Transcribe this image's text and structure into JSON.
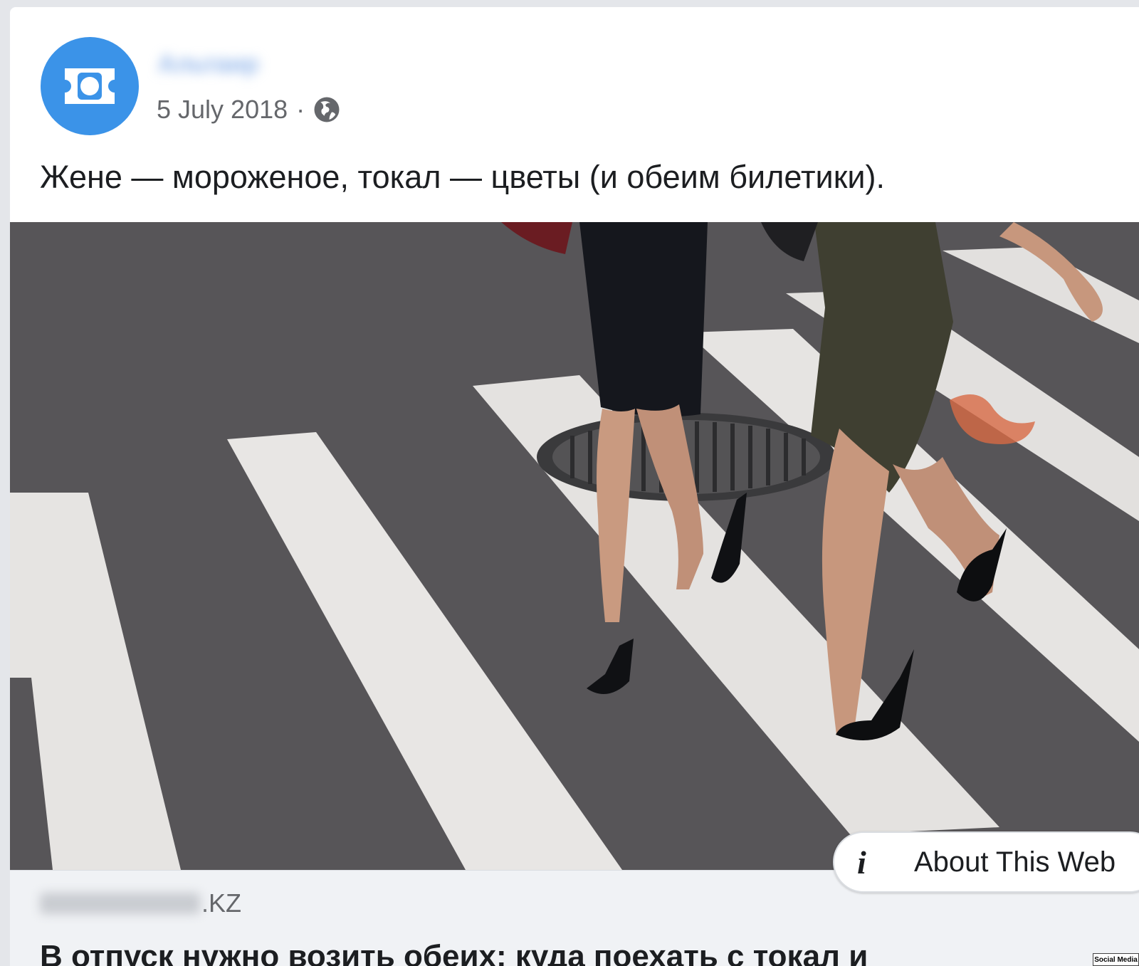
{
  "post": {
    "page_name": "Альтаир",
    "date": "5 July 2018",
    "separator": "·",
    "audience_icon": "globe-icon",
    "text": "Жене — мороженое, токал — цветы (и обеим билетики)."
  },
  "link_preview": {
    "image_icon": "crosswalk-photo",
    "domain_suffix": ".KZ",
    "headline": "В отпуск нужно возить обеих: куда поехать с токал и",
    "about_button_label": "About This Web",
    "about_button_icon": "info-icon"
  },
  "watermark": "Social Media",
  "colors": {
    "avatar_bg": "#3b93e8",
    "card_bg": "#ffffff",
    "footer_bg": "#f0f2f5",
    "secondary_text": "#65676b"
  }
}
